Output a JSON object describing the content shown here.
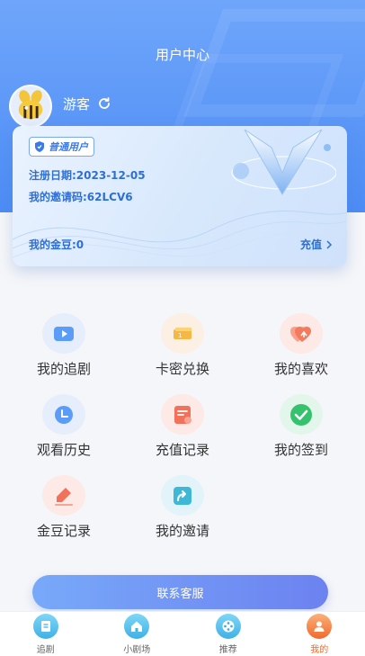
{
  "header": {
    "title": "用户中心"
  },
  "user": {
    "name": "游客"
  },
  "card": {
    "badge": "普通用户",
    "register_date": "注册日期:2023-12-05",
    "invite_code": "我的邀请码:62LCV6",
    "beans": "我的金豆:0",
    "recharge_label": "充值"
  },
  "menu": [
    {
      "label": "我的追剧",
      "icon": "play-video-icon",
      "color": "#5a9cf8",
      "bg": "#e6eefc"
    },
    {
      "label": "卡密兑换",
      "icon": "ticket-icon",
      "color": "#f6b844",
      "bg": "#fcefe3"
    },
    {
      "label": "我的喜欢",
      "icon": "heart-icon",
      "color": "#f47a5e",
      "bg": "#fde9e6"
    },
    {
      "label": "观看历史",
      "icon": "clock-icon",
      "color": "#5a9cf8",
      "bg": "#e6eefc"
    },
    {
      "label": "充值记录",
      "icon": "receipt-icon",
      "color": "#f2715a",
      "bg": "#fde9e6"
    },
    {
      "label": "我的签到",
      "icon": "check-circle-icon",
      "color": "#35c26d",
      "bg": "#e3f6ec"
    },
    {
      "label": "金豆记录",
      "icon": "pen-icon",
      "color": "#f2715a",
      "bg": "#fde9e6"
    },
    {
      "label": "我的邀请",
      "icon": "share-icon",
      "color": "#3fb8d8",
      "bg": "#e2f4f9"
    }
  ],
  "contact_button": "联系客服",
  "tabs": [
    {
      "label": "追剧",
      "icon": "document-icon"
    },
    {
      "label": "小剧场",
      "icon": "home-icon"
    },
    {
      "label": "推荐",
      "icon": "film-reel-icon"
    },
    {
      "label": "我的",
      "icon": "user-icon"
    }
  ],
  "colors": {
    "primary": "#4d8cf5",
    "active_tab": "#f06a2c"
  }
}
